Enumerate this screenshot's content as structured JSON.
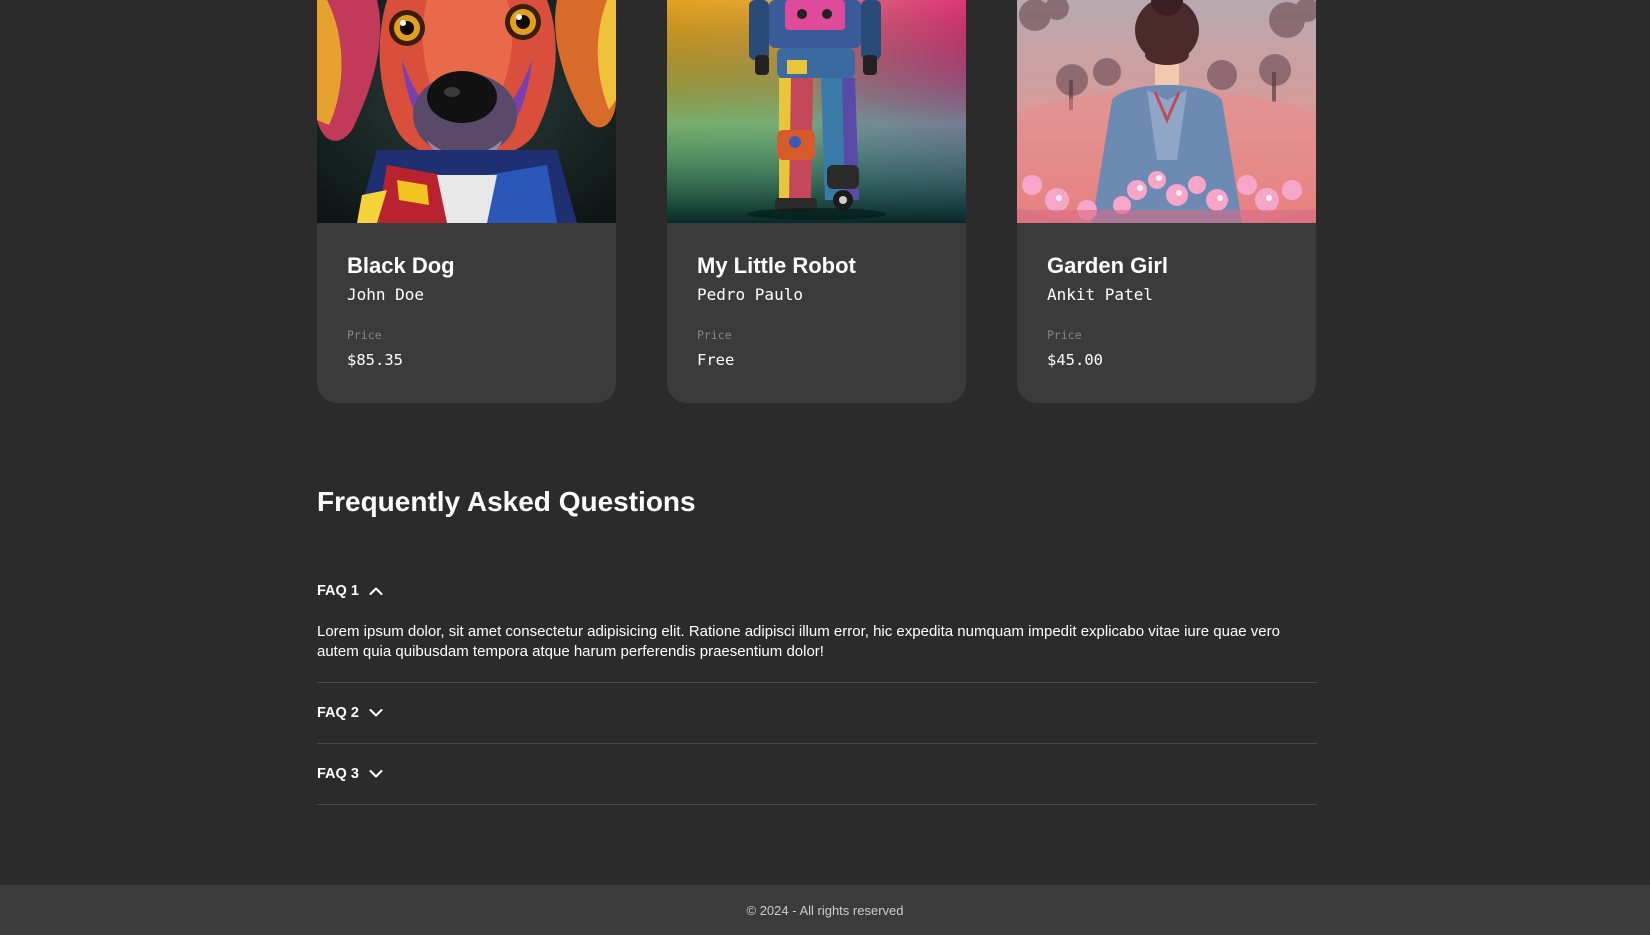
{
  "cards": [
    {
      "title": "Black Dog",
      "artist": "John Doe",
      "price_label": "Price",
      "price": "$85.35",
      "image": "colorful-dog-portrait"
    },
    {
      "title": "My Little Robot",
      "artist": "Pedro Paulo",
      "price_label": "Price",
      "price": "Free",
      "image": "robot-legs-portrait"
    },
    {
      "title": "Garden Girl",
      "artist": "Ankit Patel",
      "price_label": "Price",
      "price": "$45.00",
      "image": "girl-in-flower-garden"
    }
  ],
  "faq": {
    "title": "Frequently Asked Questions",
    "items": [
      {
        "label": "FAQ 1",
        "open": true,
        "icon": "chevron-up-icon",
        "answer": "Lorem ipsum dolor, sit amet consectetur adipisicing elit. Ratione adipisci illum error, hic expedita numquam impedit explicabo vitae iure quae vero autem quia quibusdam tempora atque harum perferendis praesentium dolor!"
      },
      {
        "label": "FAQ 2",
        "open": false,
        "icon": "chevron-down-icon",
        "answer": ""
      },
      {
        "label": "FAQ 3",
        "open": false,
        "icon": "chevron-down-icon",
        "answer": ""
      }
    ]
  },
  "footer": {
    "text": "© 2024 - All rights reserved"
  },
  "colors": {
    "background": "#2b2b2b",
    "card": "#3b3b3b",
    "footer": "#3b3b3b",
    "muted_text": "#858585",
    "divider": "#4a4a4a"
  }
}
